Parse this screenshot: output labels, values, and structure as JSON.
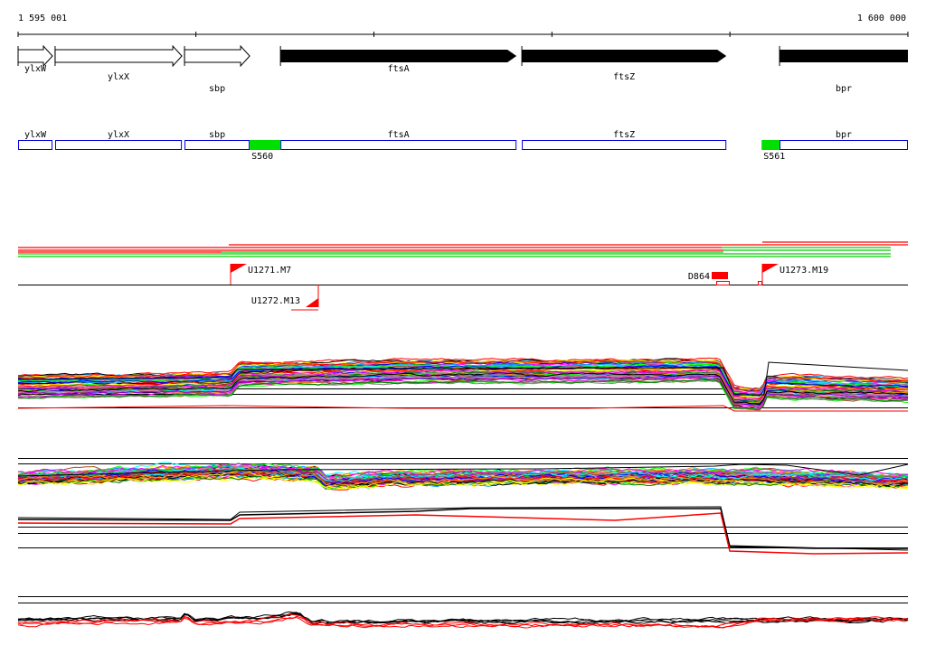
{
  "ruler": {
    "start_label": "1 595 001",
    "end_label": "1 600 000",
    "start_bp": 1595001,
    "end_bp": 1600000,
    "tick_step_bp": 1000
  },
  "annotated_genes": [
    {
      "label": "ylxW",
      "start": 1595001,
      "end": 1595194,
      "strand": "+",
      "highlight": false
    },
    {
      "label": "ylxX",
      "start": 1595209,
      "end": 1595921,
      "strand": "+",
      "highlight": false
    },
    {
      "label": "sbp",
      "start": 1595936,
      "end": 1596302,
      "strand": "+",
      "highlight": false
    },
    {
      "label": "ftsA",
      "start": 1596475,
      "end": 1597801,
      "strand": "+",
      "highlight": true
    },
    {
      "label": "ftsZ",
      "start": 1597831,
      "end": 1598980,
      "strand": "+",
      "highlight": true
    },
    {
      "label": "bpr",
      "start": 1599279,
      "end": 1600000,
      "strand": "+",
      "highlight": true
    }
  ],
  "segments": {
    "genes": [
      {
        "label": "ylxW",
        "start": 1595001,
        "end": 1595194
      },
      {
        "label": "ylxX",
        "start": 1595077,
        "end": 1595921
      },
      {
        "label": "sbp",
        "start": 1595936,
        "end": 1596302
      },
      {
        "label": "ftsA",
        "start": 1596475,
        "end": 1597801
      },
      {
        "label": "ftsZ",
        "start": 1597831,
        "end": 1598980
      },
      {
        "label": "bpr",
        "start": 1599279,
        "end": 1600000
      }
    ],
    "intergenic": [
      {
        "label": "S560",
        "start": 1596302,
        "end": 1596475
      },
      {
        "label": "S561",
        "start": 1599178,
        "end": 1599279
      }
    ]
  },
  "features": [
    {
      "label": "U1271.M7",
      "pos": 1596194,
      "strand": "+"
    },
    {
      "label": "U1272.M13",
      "pos": 1596687,
      "strand": "-"
    },
    {
      "label": "D864",
      "pos": 1598960,
      "strand": "box"
    },
    {
      "label": "U1273.M19",
      "pos": 1599183,
      "strand": "+"
    }
  ],
  "colors": {
    "accent_red": "#ff0000",
    "accent_green": "#00e000",
    "segment_blue": "#0000dd",
    "series": [
      "#ff0000",
      "#00ff00",
      "#0000ff",
      "#ff00ff",
      "#00ffff",
      "#ffff00",
      "#ff8c00",
      "#a0522d",
      "#808080",
      "#00a0ff",
      "#ff69b4",
      "#008000",
      "#9400d3",
      "#000000"
    ]
  }
}
